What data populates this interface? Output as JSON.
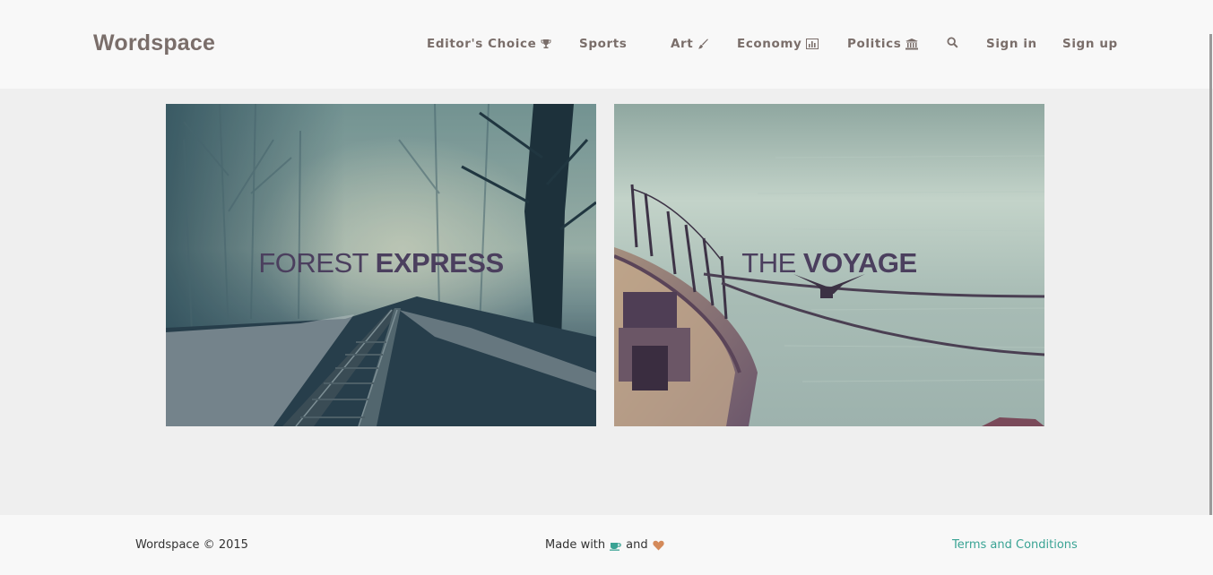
{
  "header": {
    "brand": "Wordspace",
    "nav": [
      {
        "label": "Editor's Choice",
        "icon": "trophy-icon"
      },
      {
        "label": "Sports",
        "icon": null
      },
      {
        "label": "Art",
        "icon": "paintbrush-icon"
      },
      {
        "label": "Economy",
        "icon": "bar-chart-icon"
      },
      {
        "label": "Politics",
        "icon": "institution-icon"
      }
    ],
    "search_icon": "search-icon",
    "sign_in": "Sign in",
    "sign_up": "Sign up"
  },
  "cards": [
    {
      "title_light": "FOREST",
      "title_bold": "EXPRESS",
      "image": "foggy forest railway"
    },
    {
      "title_light": "THE",
      "title_bold": "VOYAGE",
      "image": "boat on water with bird"
    }
  ],
  "footer": {
    "copyright": "Wordspace © 2015",
    "made_with": "Made with",
    "and": "and",
    "coffee_icon": "coffee-icon",
    "heart_icon": "heart-icon",
    "terms": "Terms and Conditions"
  },
  "colors": {
    "text": "#7a6e6a",
    "link": "#3aa394",
    "title": "#4b3f5e",
    "heart": "#d48a5a"
  }
}
